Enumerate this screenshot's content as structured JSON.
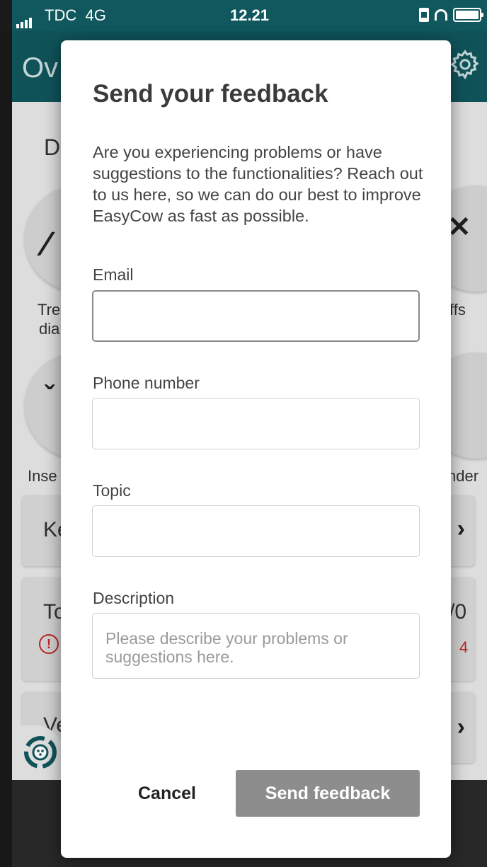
{
  "status_bar": {
    "carrier": "TDC",
    "network": "4G",
    "time": "12.21"
  },
  "app": {
    "title_fragment": "Ov",
    "section_fragment": "D",
    "tile_labels": {
      "left_1_line1": "Tre",
      "left_1_line2": "dia",
      "right_1": "ffs",
      "left_2": "Inse",
      "right_2": "nder"
    },
    "cards": {
      "row1": "Ke",
      "row2": "To",
      "row2_value": "/0",
      "row2_badge": "4",
      "row3": "Ve"
    },
    "colors": {
      "header": "#10585e",
      "background": "#e9e9e9",
      "alert": "#c62828"
    }
  },
  "dialog": {
    "title": "Send your feedback",
    "intro": "Are you experiencing problems or have suggestions to the functionalities? Reach out to us here, so we can do our best to improve EasyCow as fast as possible.",
    "email": {
      "label": "Email",
      "value": ""
    },
    "phone": {
      "label": "Phone number",
      "value": ""
    },
    "topic": {
      "label": "Topic",
      "value": ""
    },
    "description": {
      "label": "Description",
      "placeholder": "Please describe your problems or suggestions here.",
      "value": ""
    },
    "cancel_label": "Cancel",
    "send_label": "Send feedback",
    "colors": {
      "send_button": "#8d8d8d"
    }
  },
  "icons": [
    "signal-icon",
    "sim-icon",
    "headphones-icon",
    "battery-icon",
    "settings-icon",
    "alert-icon",
    "chevron-right-icon",
    "easycow-logo-icon"
  ]
}
